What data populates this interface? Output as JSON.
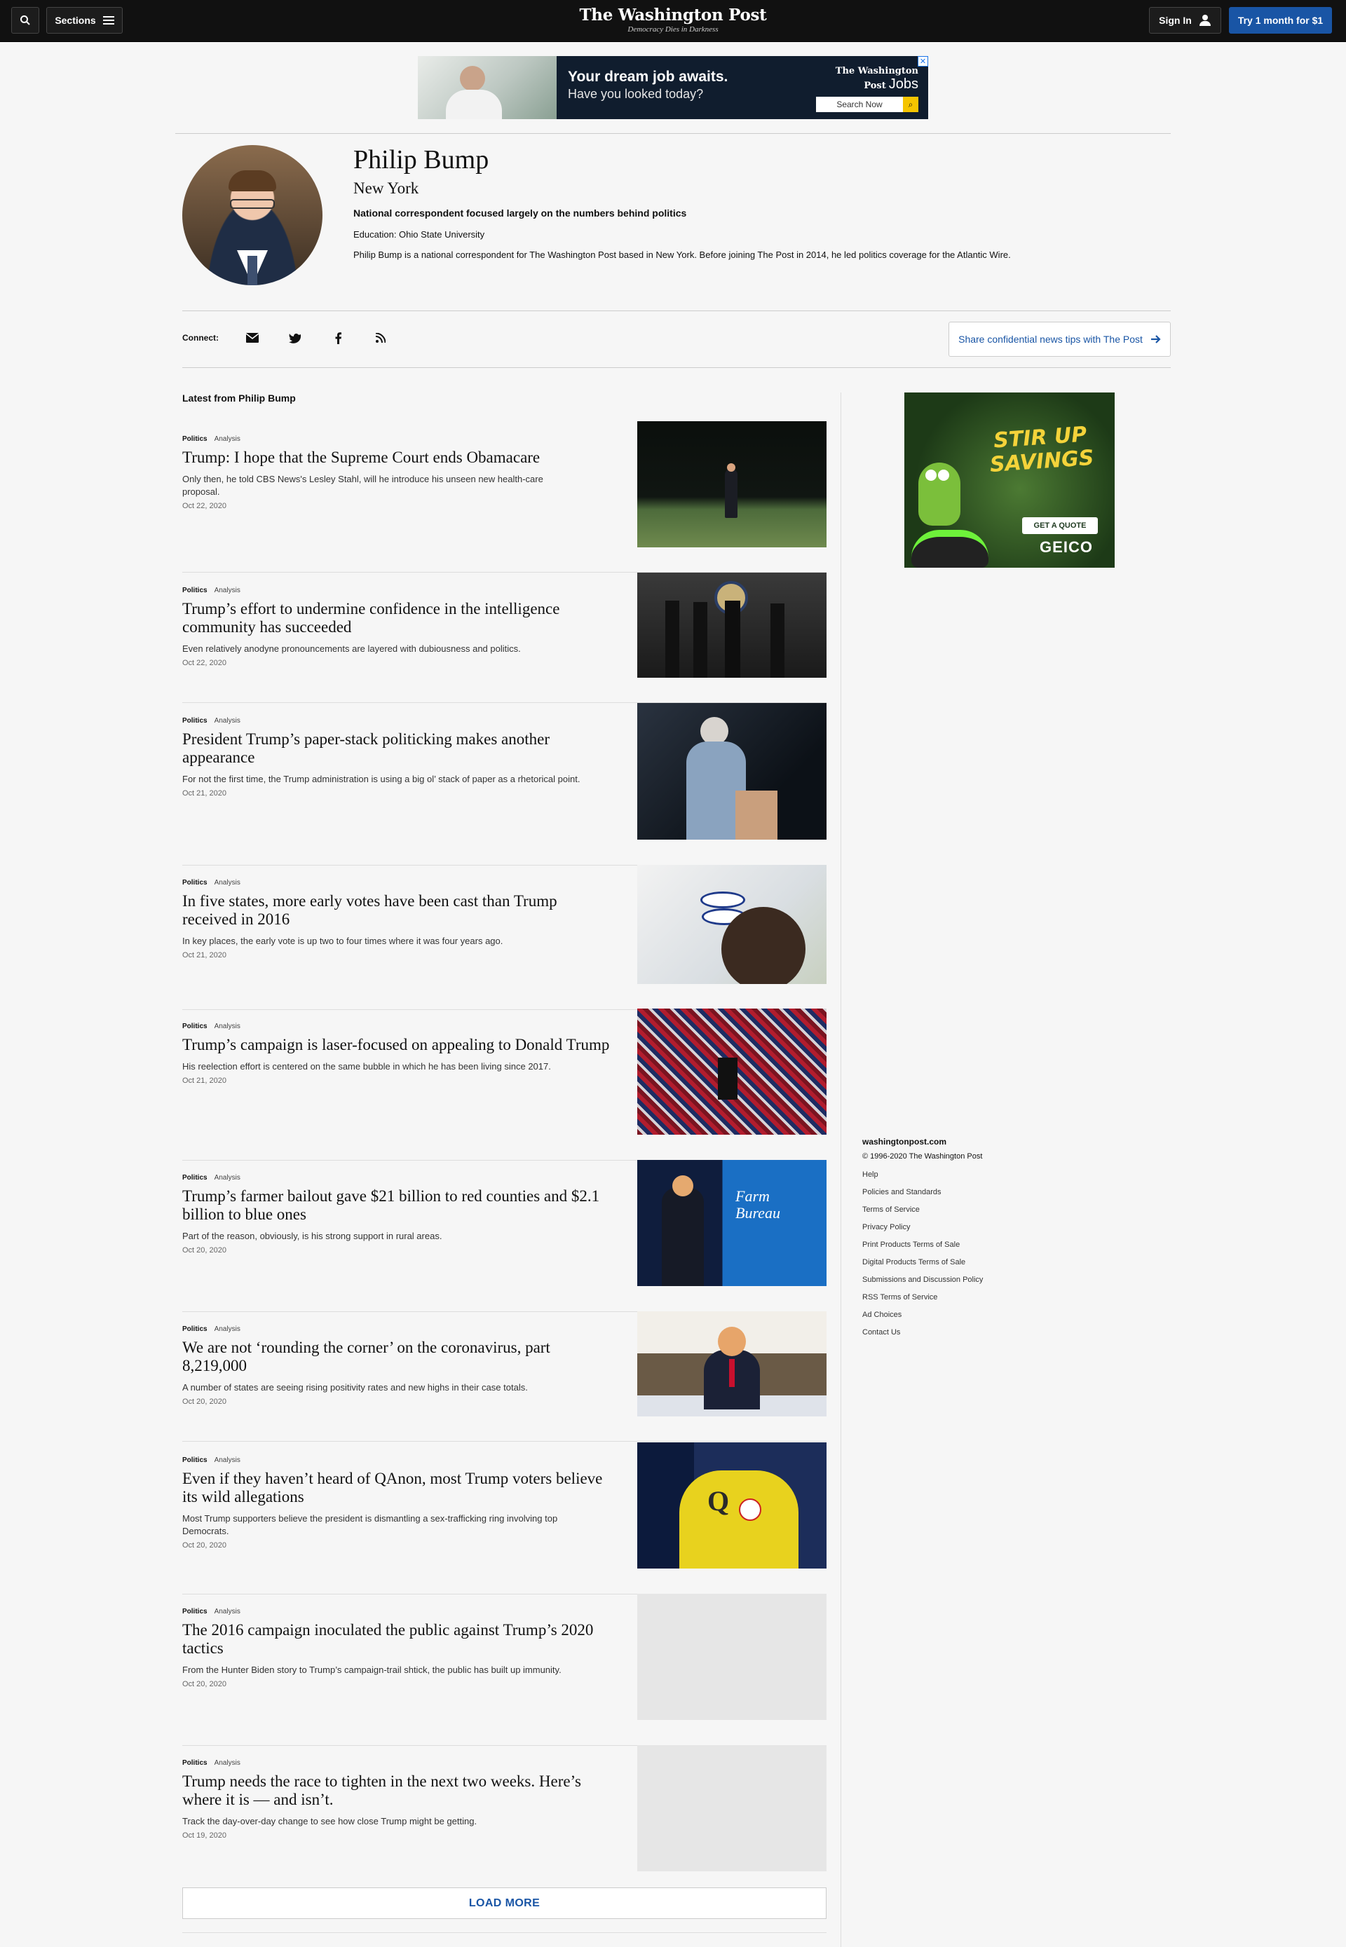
{
  "header": {
    "sections_label": "Sections",
    "logo": "The Washington Post",
    "tagline": "Democracy Dies in Darkness",
    "signin_label": "Sign In",
    "subscribe_label": "Try 1 month for $1"
  },
  "top_ad": {
    "headline": "Your dream job awaits.",
    "subhead": "Have you looked today?",
    "brand": "The Washington Post",
    "brand_suffix": "Jobs",
    "search_label": "Search Now"
  },
  "author": {
    "name": "Philip Bump",
    "city": "New York",
    "tagline": "National correspondent focused largely on the numbers behind politics",
    "education": "Education: Ohio State University",
    "bio": "Philip Bump is a national correspondent for The Washington Post based in New York. Before joining The Post in 2014, he led politics coverage for the Atlantic Wire."
  },
  "connect": {
    "label": "Connect:",
    "icons": [
      "email-icon",
      "twitter-icon",
      "facebook-icon",
      "rss-icon"
    ],
    "tip_label": "Share confidential news tips with The Post"
  },
  "latest_heading": "Latest from Philip Bump",
  "stories": [
    {
      "section": "Politics",
      "label": "Analysis",
      "headline": "Trump: I hope that the Supreme Court ends Obamacare",
      "blurb": "Only then, he told CBS News's Lesley Stahl, will he introduce his unseen new health-care proposal.",
      "date": "Oct 22, 2020",
      "image": "trump-walking-lawn-night"
    },
    {
      "section": "Politics",
      "label": "Analysis",
      "headline": "Trump’s effort to undermine confidence in the intelligence community has succeeded",
      "blurb": "Even relatively anodyne pronouncements are layered with dubiousness and politics.",
      "date": "Oct 22, 2020",
      "image": "officials-at-podium"
    },
    {
      "section": "Politics",
      "label": "Analysis",
      "headline": "President Trump’s paper-stack politicking makes another appearance",
      "blurb": "For not the first time, the Trump administration is using a big ol’ stack of paper as a rhetorical point.",
      "date": "Oct 21, 2020",
      "image": "woman-with-paper-stack"
    },
    {
      "section": "Politics",
      "label": "Analysis",
      "headline": "In five states, more early votes have been cast than Trump received in 2016",
      "blurb": "In key places, the early vote is up two to four times where it was four years ago.",
      "date": "Oct 21, 2020",
      "image": "i-voted-stickers"
    },
    {
      "section": "Politics",
      "label": "Analysis",
      "headline": "Trump’s campaign is laser-focused on appealing to Donald Trump",
      "blurb": "His reelection effort is centered on the same bubble in which he has been living since 2017.",
      "date": "Oct 21, 2020",
      "image": "rally-crowd"
    },
    {
      "section": "Politics",
      "label": "Analysis",
      "headline": "Trump’s farmer bailout gave $21 billion to red counties and $2.1 billion to blue ones",
      "blurb": "Part of the reason, obviously, is his strong support in rural areas.",
      "date": "Oct 20, 2020",
      "image": "farm-bureau-speech"
    },
    {
      "section": "Politics",
      "label": "Analysis",
      "headline": "We are not ‘rounding the corner’ on the coronavirus, part 8,219,000",
      "blurb": "A number of states are seeing rising positivity rates and new highs in their case totals.",
      "date": "Oct 20, 2020",
      "image": "trump-speaking-table"
    },
    {
      "section": "Politics",
      "label": "Analysis",
      "headline": "Even if they haven’t heard of QAnon, most Trump voters believe its wild allegations",
      "blurb": "Most Trump supporters believe the president is dismantling a sex-trafficking ring involving top Democrats.",
      "date": "Oct 20, 2020",
      "image": "qanon-shirt"
    },
    {
      "section": "Politics",
      "label": "Analysis",
      "headline": "The 2016 campaign inoculated the public against Trump’s 2020 tactics",
      "blurb": "From the Hunter Biden story to Trump’s campaign-trail shtick, the public has built up immunity.",
      "date": "Oct 20, 2020",
      "image": "placeholder"
    },
    {
      "section": "Politics",
      "label": "Analysis",
      "headline": "Trump needs the race to tighten in the next two weeks. Here’s where it is — and isn’t.",
      "blurb": "Track the day-over-day change to see how close Trump might be getting.",
      "date": "Oct 19, 2020",
      "image": "placeholder"
    }
  ],
  "load_more_label": "LOAD MORE",
  "side_ad": {
    "headline": "STIR UP SAVINGS",
    "cta": "GET A QUOTE",
    "brand": "GEICO"
  },
  "footer": {
    "site": "washingtonpost.com",
    "copyright": "© 1996-2020 The Washington Post",
    "links": [
      "Help",
      "Policies and Standards",
      "Terms of Service",
      "Privacy Policy",
      "Print Products Terms of Sale",
      "Digital Products Terms of Sale",
      "Submissions and Discussion Policy",
      "RSS Terms of Service",
      "Ad Choices",
      "Contact Us"
    ]
  }
}
